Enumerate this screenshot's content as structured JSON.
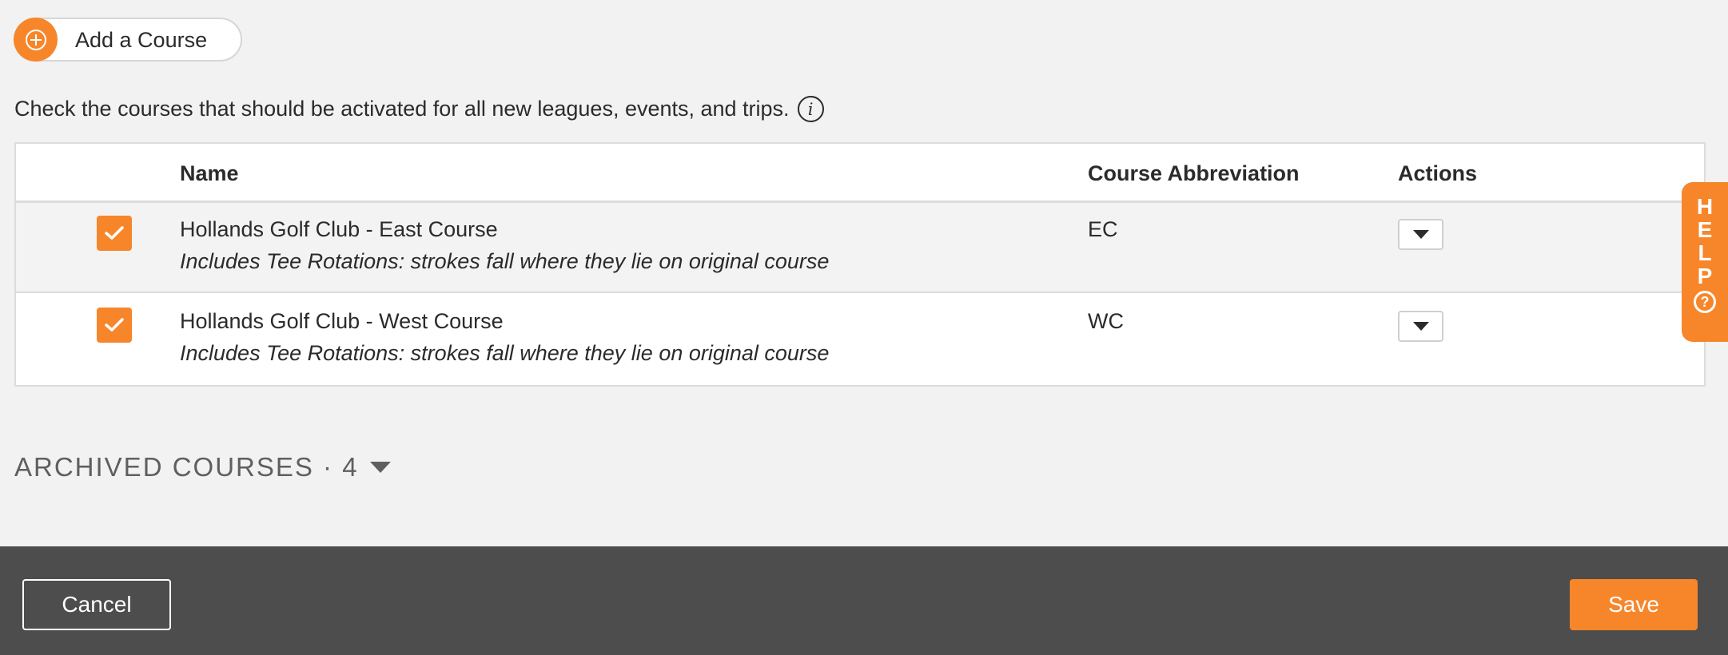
{
  "add_course": {
    "label": "Add a Course",
    "icon": "plus-circle-icon"
  },
  "intro": {
    "text": "Check the courses that should be activated for all new leagues, events, and trips.",
    "icon": "info-icon"
  },
  "table": {
    "headers": {
      "name": "Name",
      "abbreviation": "Course Abbreviation",
      "actions": "Actions"
    },
    "rows": [
      {
        "checked": true,
        "name": "Hollands Golf Club - East Course",
        "note": "Includes Tee Rotations: strokes fall where they lie on original course",
        "abbreviation": "EC"
      },
      {
        "checked": true,
        "name": "Hollands Golf Club - West Course",
        "note": "Includes Tee Rotations: strokes fall where they lie on original course",
        "abbreviation": "WC"
      }
    ]
  },
  "archived": {
    "label": "ARCHIVED COURSES · 4"
  },
  "help": {
    "label": "HELP",
    "icon": "question-circle-icon"
  },
  "footer": {
    "cancel_label": "Cancel",
    "save_label": "Save"
  },
  "colors": {
    "accent": "#f7862a",
    "footer_bg": "#4d4d4d",
    "page_bg": "#f2f2f2"
  }
}
